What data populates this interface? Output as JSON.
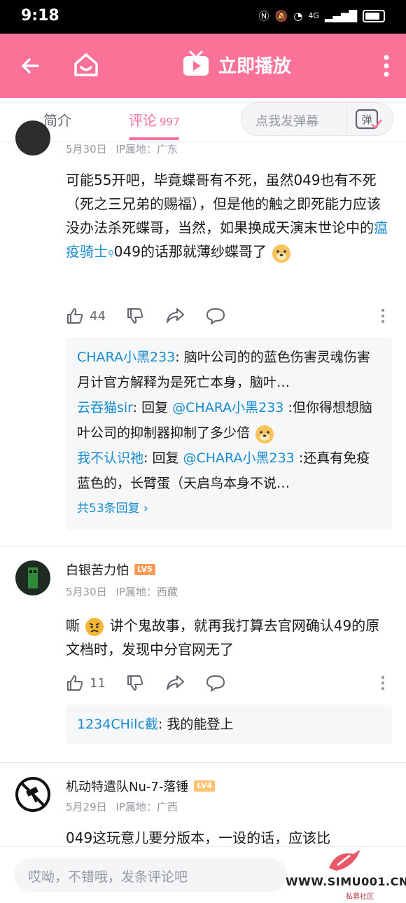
{
  "status": {
    "time": "9:18",
    "network": "4G"
  },
  "topbar": {
    "play_label": "立即播放"
  },
  "tabs": {
    "intro": "简介",
    "comments": "评论",
    "comments_count": "997"
  },
  "danmaku": {
    "placeholder": "点我发弹幕",
    "button": "弹"
  },
  "comment1": {
    "date": "5月30日",
    "ip": "IP属地：广东",
    "text_a": "可能55开吧，毕竟蝶哥有不死，虽然049也有不死（死之三兄弟的赐福），但是他的触之即死能力应该没办法杀死蝶哥，当然，如果换成天演末世论中的",
    "link": "瘟疫骑士",
    "text_b": "049的话那就薄纱蝶哥了",
    "likes": "44",
    "replies": [
      {
        "name": "CHARA小黑233",
        "sep": ": ",
        "text": "脑叶公司的的蓝色伤害灵魂伤害月计官方解释为是死亡本身，脑叶…"
      },
      {
        "name": "云吞猫sir",
        "sep": ": 回复 ",
        "mention": "@CHARA小黑233",
        "text": " :但你得想想脑叶公司的抑制器抑制了多少倍"
      },
      {
        "name": "我不认识祂",
        "sep": ": 回复 ",
        "mention": "@CHARA小黑233",
        "text": " :还真有免疫蓝色的，长臂蛋（天启鸟本身不说…"
      }
    ],
    "more_replies": "共53条回复 ›"
  },
  "comment2": {
    "username": "白银苦力怕",
    "level": "LV5",
    "date": "5月30日",
    "ip": "IP属地：西藏",
    "text_a": "嘶",
    "text_b": "讲个鬼故事，就再我打算去官网确认49的原文档时，发现中分官网无了",
    "likes": "11",
    "reply": {
      "name": "1234CHilc截",
      "sep": ": ",
      "text": "我的能登上"
    }
  },
  "comment3": {
    "username": "机动特遣队Nu-7-落锤",
    "level": "LV4",
    "date": "5月29日",
    "ip": "IP属地：广西",
    "text": "049这玩意儿要分版本，一设的话，应该比"
  },
  "bottombar": {
    "placeholder": "哎呦，不错哦，发条评论吧"
  },
  "watermark": {
    "text": "WWW.SIMU001.CN",
    "sub": "私募社区"
  },
  "colors": {
    "brand_pink": "#fb7299",
    "link_blue": "#178bcf",
    "lv5": "#ff9a58",
    "lv4": "#ffc26f"
  }
}
